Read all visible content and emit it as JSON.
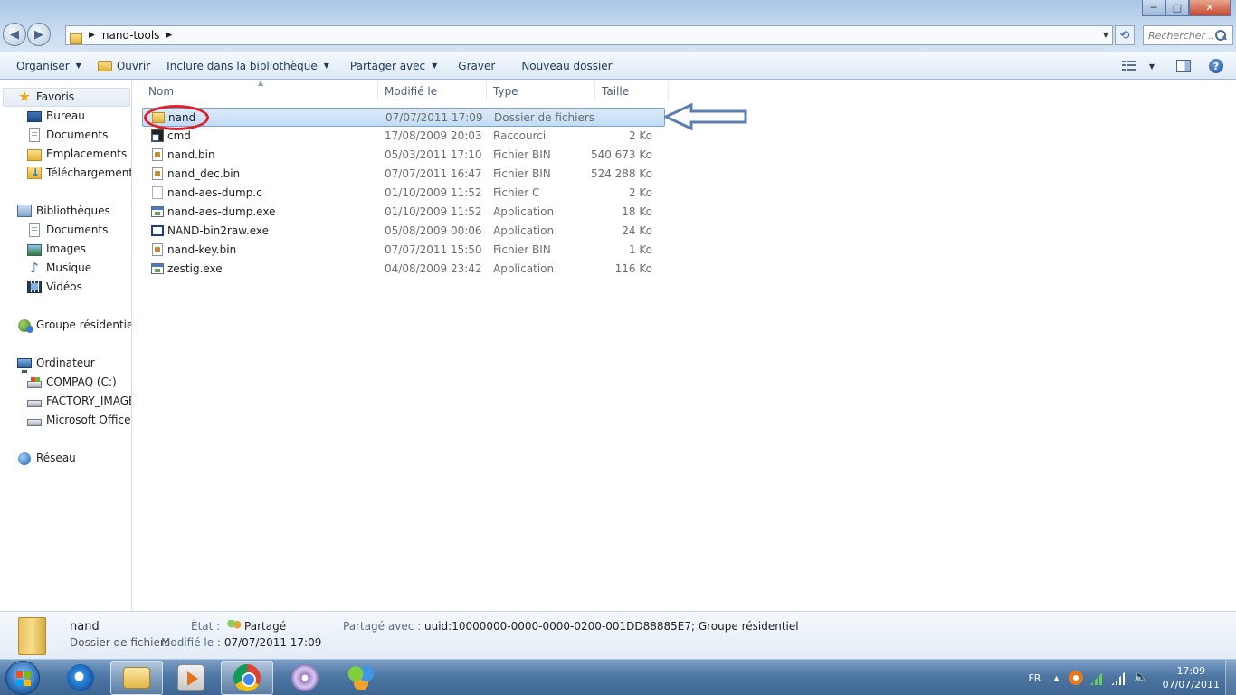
{
  "window": {
    "controls": {
      "minimize": "─",
      "maximize": "□",
      "close": "✕"
    }
  },
  "address_bar": {
    "breadcrumb": [
      "nand-tools"
    ],
    "search_placeholder": "Rechercher ..."
  },
  "toolbar": {
    "organize": "Organiser",
    "open": "Ouvrir",
    "include_library": "Inclure dans la bibliothèque",
    "share_with": "Partager avec",
    "burn": "Graver",
    "new_folder": "Nouveau dossier",
    "help": "?"
  },
  "sidebar": {
    "favorites": {
      "label": "Favoris",
      "items": [
        {
          "label": "Bureau",
          "icon": "desktop-icon"
        },
        {
          "label": "Documents",
          "icon": "document-icon"
        },
        {
          "label": "Emplacements ré",
          "icon": "recent-places-icon"
        },
        {
          "label": "Téléchargements",
          "icon": "downloads-icon"
        }
      ]
    },
    "libraries": {
      "label": "Bibliothèques",
      "items": [
        {
          "label": "Documents",
          "icon": "document-icon"
        },
        {
          "label": "Images",
          "icon": "images-icon"
        },
        {
          "label": "Musique",
          "icon": "music-icon"
        },
        {
          "label": "Vidéos",
          "icon": "videos-icon"
        }
      ]
    },
    "homegroup": {
      "label": "Groupe résidentiel"
    },
    "computer": {
      "label": "Ordinateur",
      "items": [
        {
          "label": "COMPAQ (C:)",
          "icon": "system-drive-icon"
        },
        {
          "label": "FACTORY_IMAGE",
          "icon": "drive-icon"
        },
        {
          "label": "Microsoft Office D",
          "icon": "drive-icon"
        }
      ]
    },
    "network": {
      "label": "Réseau"
    }
  },
  "file_list": {
    "columns": {
      "name": "Nom",
      "modified": "Modifié le",
      "type": "Type",
      "size": "Taille"
    },
    "rows": [
      {
        "name": "nand",
        "modified": "07/07/2011 17:09",
        "type": "Dossier de fichiers",
        "size": "",
        "icon": "folder-icon",
        "selected": true
      },
      {
        "name": "cmd",
        "modified": "17/08/2009 20:03",
        "type": "Raccourci",
        "size": "2 Ko",
        "icon": "shortcut-icon"
      },
      {
        "name": "nand.bin",
        "modified": "05/03/2011 17:10",
        "type": "Fichier BIN",
        "size": "540 673 Ko",
        "icon": "bin-file-icon"
      },
      {
        "name": "nand_dec.bin",
        "modified": "07/07/2011 16:47",
        "type": "Fichier BIN",
        "size": "524 288 Ko",
        "icon": "bin-file-icon"
      },
      {
        "name": "nand-aes-dump.c",
        "modified": "01/10/2009 11:52",
        "type": "Fichier C",
        "size": "2 Ko",
        "icon": "c-file-icon"
      },
      {
        "name": "nand-aes-dump.exe",
        "modified": "01/10/2009 11:52",
        "type": "Application",
        "size": "18 Ko",
        "icon": "exe-icon"
      },
      {
        "name": "NAND-bin2raw.exe",
        "modified": "05/08/2009 00:06",
        "type": "Application",
        "size": "24 Ko",
        "icon": "exe-window-icon"
      },
      {
        "name": "nand-key.bin",
        "modified": "07/07/2011 15:50",
        "type": "Fichier BIN",
        "size": "1 Ko",
        "icon": "bin-file-icon"
      },
      {
        "name": "zestig.exe",
        "modified": "04/08/2009 23:42",
        "type": "Application",
        "size": "116 Ko",
        "icon": "exe-icon"
      }
    ]
  },
  "annotations": {
    "highlight_color": "#e0202c",
    "arrow_color": "#5b7fb0"
  },
  "details_pane": {
    "name": "nand",
    "type": "Dossier de fichiers",
    "state_label": "État :",
    "state_value": "Partagé",
    "modified_label": "Modifié le :",
    "modified_value": "07/07/2011 17:09",
    "shared_label": "Partagé avec :",
    "shared_value": "uuid:10000000-0000-0000-0200-001DD88885E7; Groupe résidentiel"
  },
  "taskbar": {
    "apps": [
      "internet-explorer-icon",
      "windows-explorer-icon",
      "media-player-icon",
      "chrome-icon",
      "dvd-maker-icon",
      "messenger-icon"
    ],
    "tray": {
      "language": "FR",
      "time": "17:09",
      "date": "07/07/2011"
    }
  }
}
